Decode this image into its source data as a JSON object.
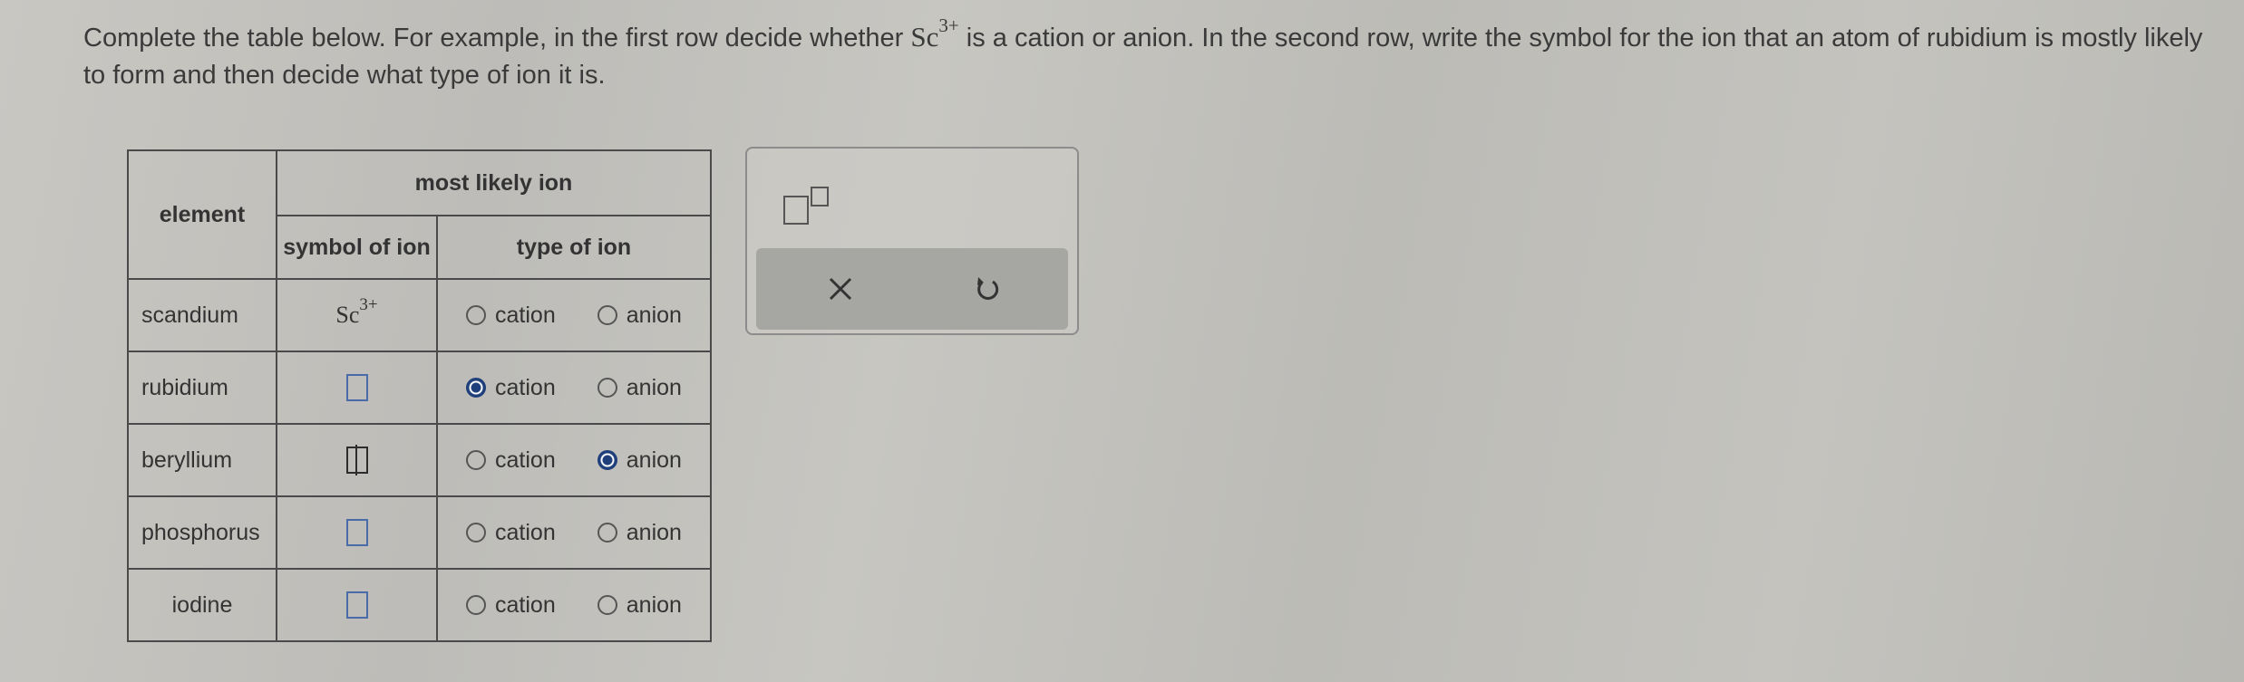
{
  "prompt": {
    "before": "Complete the table below. For example, in the first row decide whether ",
    "ion_base": "Sc",
    "ion_charge": "3+",
    "after": " is a cation or anion. In the second row, write the symbol for the ion that an atom of rubidium is mostly likely to form and then decide what type of ion it is."
  },
  "table": {
    "header_element": "element",
    "header_group": "most likely ion",
    "header_symbol": "symbol of ion",
    "header_type": "type of ion",
    "option_cation": "cation",
    "option_anion": "anion",
    "rows": [
      {
        "element": "scandium",
        "symbol_base": "Sc",
        "symbol_charge": "3+",
        "selected": "none"
      },
      {
        "element": "rubidium",
        "symbol_base": "",
        "symbol_charge": "",
        "selected": "cation"
      },
      {
        "element": "beryllium",
        "symbol_base": "",
        "symbol_charge": "",
        "selected": "anion"
      },
      {
        "element": "phosphorus",
        "symbol_base": "",
        "symbol_charge": "",
        "selected": "none"
      },
      {
        "element": "iodine",
        "symbol_base": "",
        "symbol_charge": "",
        "selected": "none"
      }
    ]
  },
  "tools": {
    "superscript_icon": "superscript-box-icon",
    "clear_icon": "close-icon",
    "undo_icon": "undo-icon"
  },
  "colors": {
    "selected_radio": "#1f3f7a",
    "input_box": "#4a6aa8"
  }
}
